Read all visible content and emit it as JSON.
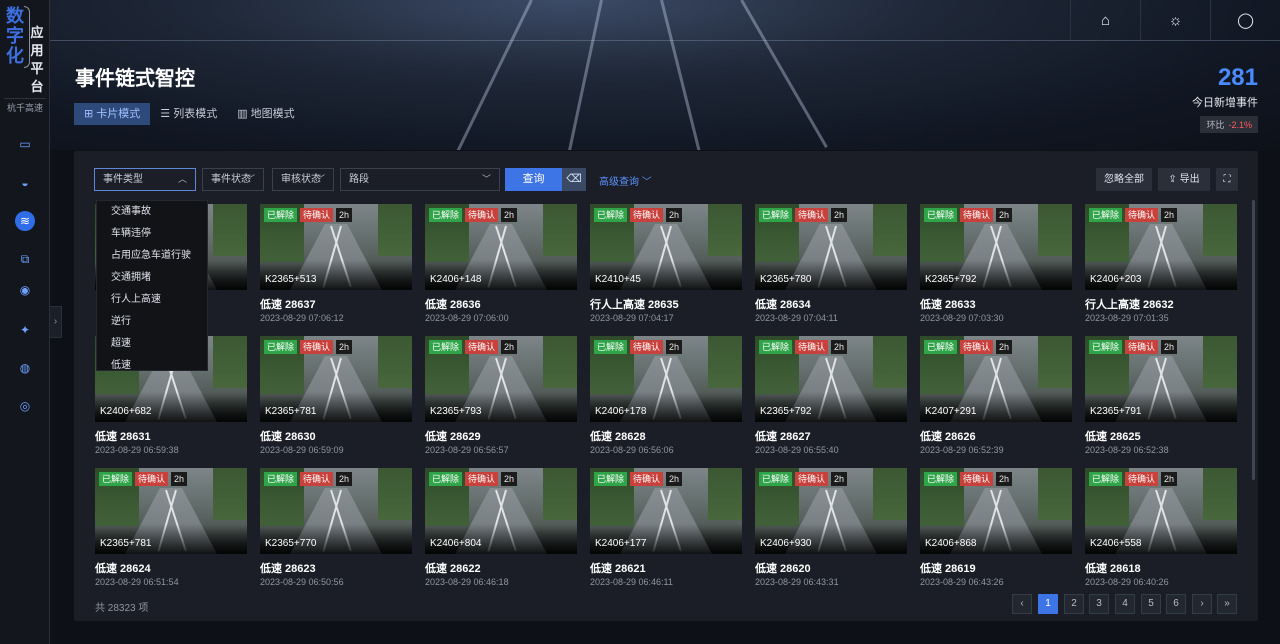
{
  "logo": {
    "big": "数字化",
    "small": "应用平台",
    "sub": "杭千高速"
  },
  "header": {
    "title": "事件链式智控",
    "icons": [
      "home-icon",
      "sun-icon",
      "user-icon"
    ]
  },
  "view_modes": [
    {
      "label": "卡片模式",
      "icon": "grid-icon",
      "active": true
    },
    {
      "label": "列表模式",
      "icon": "list-icon",
      "active": false
    },
    {
      "label": "地图模式",
      "icon": "map-icon",
      "active": false
    }
  ],
  "stats": {
    "count": "281",
    "label": "今日新增事件",
    "change_label": "环比",
    "change_value": "-2.1%"
  },
  "filters": {
    "event_type": "事件类型",
    "event_status": "事件状态",
    "review_status": "审核状态",
    "road": "路段",
    "query": "查询",
    "advanced": "高级查询",
    "ignore_all": "忽略全部",
    "export": "导出"
  },
  "dropdown_options": [
    "交通事故",
    "车辆违停",
    "占用应急车道行驶",
    "交通拥堵",
    "行人上高速",
    "逆行",
    "超速",
    "低速"
  ],
  "badges": {
    "resolved": "已解除",
    "pending": "待确认"
  },
  "cards": [
    {
      "title": "",
      "time": "",
      "loc": "",
      "age": "2h",
      "visible": false
    },
    {
      "title": "低速 28637",
      "time": "2023-08-29 07:06:12",
      "loc": "K2365+513",
      "age": "2h"
    },
    {
      "title": "低速 28636",
      "time": "2023-08-29 07:06:00",
      "loc": "K2406+148",
      "age": "2h"
    },
    {
      "title": "行人上高速 28635",
      "time": "2023-08-29 07:04:17",
      "loc": "K2410+45",
      "age": "2h"
    },
    {
      "title": "低速 28634",
      "time": "2023-08-29 07:04:11",
      "loc": "K2365+780",
      "age": "2h"
    },
    {
      "title": "低速 28633",
      "time": "2023-08-29 07:03:30",
      "loc": "K2365+792",
      "age": "2h"
    },
    {
      "title": "行人上高速 28632",
      "time": "2023-08-29 07:01:35",
      "loc": "K2406+203",
      "age": "2h"
    },
    {
      "title": "低速 28631",
      "time": "2023-08-29 06:59:38",
      "loc": "K2406+682",
      "age": "2h"
    },
    {
      "title": "低速 28630",
      "time": "2023-08-29 06:59:09",
      "loc": "K2365+781",
      "age": "2h"
    },
    {
      "title": "低速 28629",
      "time": "2023-08-29 06:56:57",
      "loc": "K2365+793",
      "age": "2h"
    },
    {
      "title": "低速 28628",
      "time": "2023-08-29 06:56:06",
      "loc": "K2406+178",
      "age": "2h"
    },
    {
      "title": "低速 28627",
      "time": "2023-08-29 06:55:40",
      "loc": "K2365+792",
      "age": "2h"
    },
    {
      "title": "低速 28626",
      "time": "2023-08-29 06:52:39",
      "loc": "K2407+291",
      "age": "2h"
    },
    {
      "title": "低速 28625",
      "time": "2023-08-29 06:52:38",
      "loc": "K2365+791",
      "age": "2h"
    },
    {
      "title": "低速 28624",
      "time": "2023-08-29 06:51:54",
      "loc": "K2365+781",
      "age": "2h"
    },
    {
      "title": "低速 28623",
      "time": "2023-08-29 06:50:56",
      "loc": "K2365+770",
      "age": "2h"
    },
    {
      "title": "低速 28622",
      "time": "2023-08-29 06:46:18",
      "loc": "K2406+804",
      "age": "2h"
    },
    {
      "title": "低速 28621",
      "time": "2023-08-29 06:46:11",
      "loc": "K2406+177",
      "age": "2h"
    },
    {
      "title": "低速 28620",
      "time": "2023-08-29 06:43:31",
      "loc": "K2406+930",
      "age": "2h"
    },
    {
      "title": "低速 28619",
      "time": "2023-08-29 06:43:26",
      "loc": "K2406+868",
      "age": "2h"
    },
    {
      "title": "低速 28618",
      "time": "2023-08-29 06:40:26",
      "loc": "K2406+558",
      "age": "2h"
    }
  ],
  "footer": {
    "total": "共 28323 项"
  },
  "pagination": {
    "pages": [
      "1",
      "2",
      "3",
      "4",
      "5",
      "6"
    ],
    "active": "1",
    "prev": "‹",
    "next": "›",
    "last": "»"
  },
  "colors": {
    "accent": "#3d74e6",
    "resolved": "#2fa449",
    "pending": "#c9413c",
    "change_down": "#ff5a5a"
  }
}
